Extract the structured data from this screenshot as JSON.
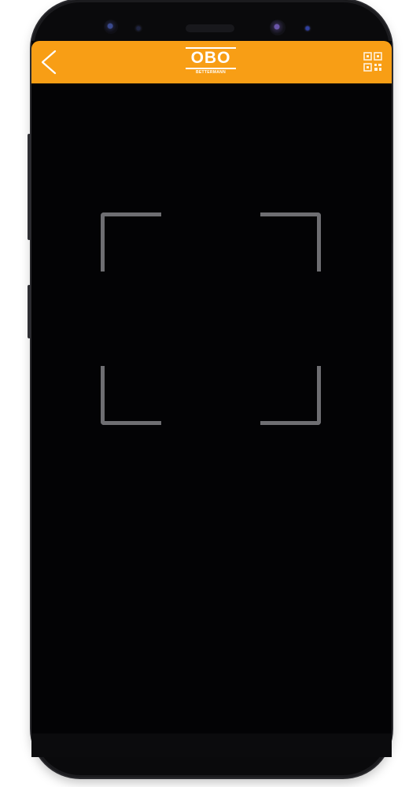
{
  "app": {
    "logo": {
      "main": "OBO",
      "sub": "BETTERMANN"
    }
  },
  "header": {
    "background_color": "#f89e15",
    "back_icon": "chevron-left-icon",
    "action_icon": "qr-code-icon"
  },
  "scanner": {
    "frame_color": "#6e6e72",
    "background_color": "#030305"
  }
}
